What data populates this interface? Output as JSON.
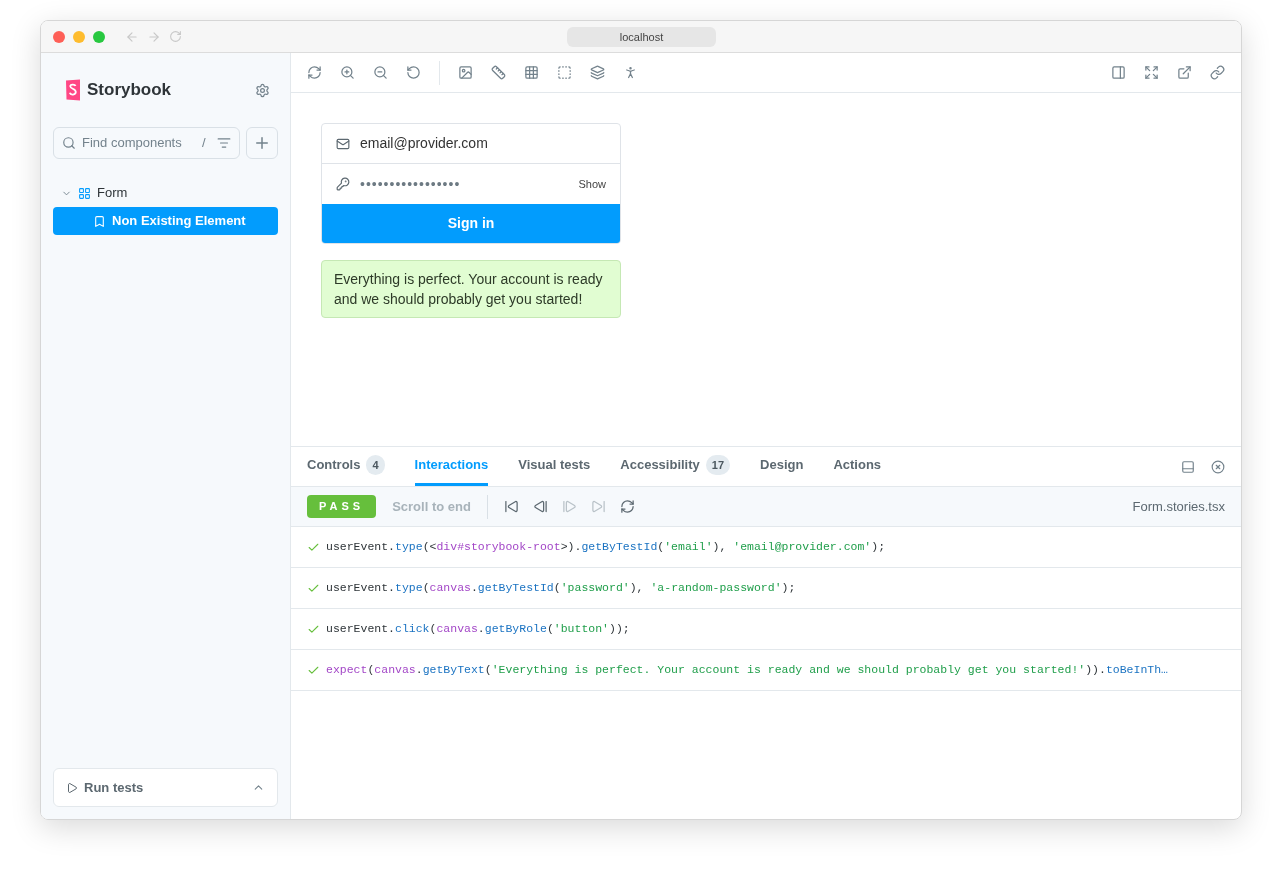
{
  "browser": {
    "url": "localhost",
    "back_disabled": true,
    "forward_disabled": true
  },
  "sidebar": {
    "brand": "Storybook",
    "search": {
      "placeholder": "Find components",
      "shortcut": "/"
    },
    "tree": [
      {
        "label": "Form",
        "kind": "component",
        "expanded": true,
        "selected": false,
        "children": [
          {
            "label": "Non Existing Element",
            "kind": "story",
            "selected": true
          }
        ]
      }
    ],
    "run_tests": {
      "label": "Run tests"
    }
  },
  "preview": {
    "email": "email@provider.com",
    "password": "•••••••••••••••••",
    "show": "Show",
    "submit": "Sign in",
    "message": "Everything is perfect. Your account is ready and we should probably get you started!"
  },
  "addons": {
    "tabs": [
      {
        "label": "Controls",
        "count": "4",
        "selected": false
      },
      {
        "label": "Interactions",
        "selected": true
      },
      {
        "label": "Visual tests",
        "selected": false
      },
      {
        "label": "Accessibility",
        "count": "17",
        "selected": false
      },
      {
        "label": "Design",
        "selected": false
      },
      {
        "label": "Actions",
        "selected": false
      }
    ],
    "status": "PASS",
    "scroll_to_end": {
      "label": "Scroll to end",
      "disabled": true
    },
    "controls": [
      {
        "kind": "first",
        "disabled": false
      },
      {
        "kind": "previous",
        "disabled": false
      },
      {
        "kind": "next",
        "disabled": true
      },
      {
        "kind": "last",
        "disabled": true
      },
      {
        "kind": "rerun",
        "disabled": false
      }
    ],
    "file": "Form.stories.tsx",
    "steps": [
      {
        "passed": true,
        "tokens": [
          {
            "kind": "plain",
            "text": "userEvent."
          },
          {
            "kind": "method",
            "text": "type"
          },
          {
            "kind": "plain",
            "text": "(<"
          },
          {
            "kind": "var",
            "text": "div#storybook-root"
          },
          {
            "kind": "plain",
            "text": ">)."
          },
          {
            "kind": "method",
            "text": "getByTestId"
          },
          {
            "kind": "plain",
            "text": "("
          },
          {
            "kind": "string",
            "text": "'email'"
          },
          {
            "kind": "plain",
            "text": "), "
          },
          {
            "kind": "string",
            "text": "'email@provider.com'"
          },
          {
            "kind": "plain",
            "text": ");"
          }
        ]
      },
      {
        "passed": true,
        "tokens": [
          {
            "kind": "plain",
            "text": "userEvent."
          },
          {
            "kind": "method",
            "text": "type"
          },
          {
            "kind": "plain",
            "text": "("
          },
          {
            "kind": "var",
            "text": "canvas"
          },
          {
            "kind": "plain",
            "text": "."
          },
          {
            "kind": "method",
            "text": "getByTestId"
          },
          {
            "kind": "plain",
            "text": "("
          },
          {
            "kind": "string",
            "text": "'password'"
          },
          {
            "kind": "plain",
            "text": "), "
          },
          {
            "kind": "string",
            "text": "'a-random-password'"
          },
          {
            "kind": "plain",
            "text": ");"
          }
        ]
      },
      {
        "passed": true,
        "tokens": [
          {
            "kind": "plain",
            "text": "userEvent."
          },
          {
            "kind": "method",
            "text": "click"
          },
          {
            "kind": "plain",
            "text": "("
          },
          {
            "kind": "var",
            "text": "canvas"
          },
          {
            "kind": "plain",
            "text": "."
          },
          {
            "kind": "method",
            "text": "getByRole"
          },
          {
            "kind": "plain",
            "text": "("
          },
          {
            "kind": "string",
            "text": "'button'"
          },
          {
            "kind": "plain",
            "text": "));"
          }
        ]
      },
      {
        "passed": true,
        "tokens": [
          {
            "kind": "var",
            "text": "expect"
          },
          {
            "kind": "plain",
            "text": "("
          },
          {
            "kind": "var",
            "text": "canvas"
          },
          {
            "kind": "plain",
            "text": "."
          },
          {
            "kind": "method",
            "text": "getByText"
          },
          {
            "kind": "plain",
            "text": "("
          },
          {
            "kind": "string",
            "text": "'Everything is perfect. Your account is ready and we should probably get you started!'"
          },
          {
            "kind": "plain",
            "text": "))."
          },
          {
            "kind": "method",
            "text": "toBeInTh…"
          }
        ]
      }
    ]
  }
}
